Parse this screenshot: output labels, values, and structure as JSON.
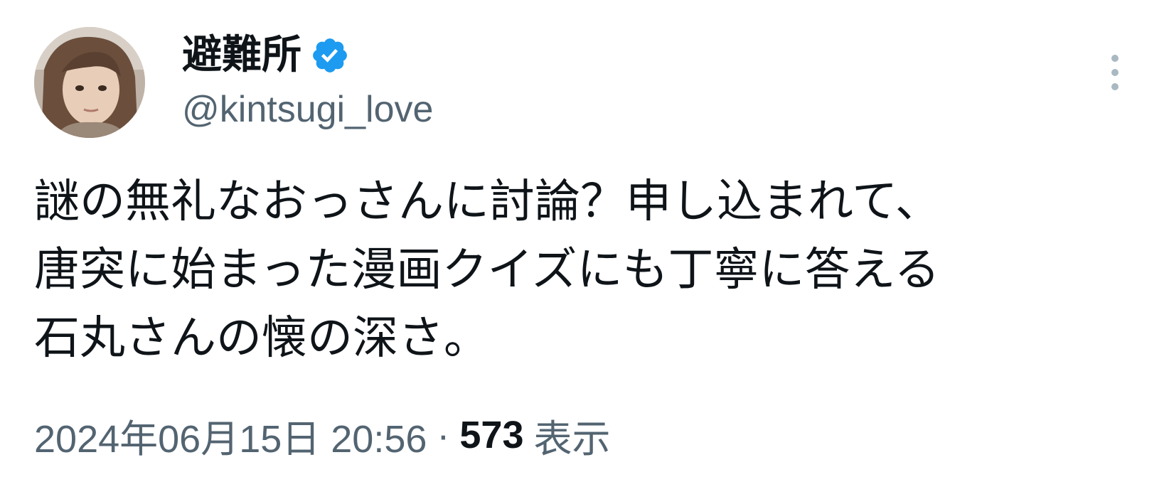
{
  "author": {
    "display_name": "避難所",
    "handle": "@kintsugi_love",
    "verified": true
  },
  "tweet": {
    "text_lines": [
      "謎の無礼なおっさんに討論？申し込まれて、",
      "唐突に始まった漫画クイズにも丁寧に答える",
      "石丸さんの懐の深さ。"
    ],
    "timestamp": "2024年06月15日 20:56",
    "separator": "·",
    "views_count": "573",
    "views_label": "表示"
  },
  "icons": {
    "verified": "verified-badge-icon",
    "more": "more-vertical-icon"
  },
  "colors": {
    "verified_blue": "#1d9bf0",
    "secondary_text": "#536471",
    "primary_text": "#0f1419",
    "more_icon": "#aab8c2"
  }
}
